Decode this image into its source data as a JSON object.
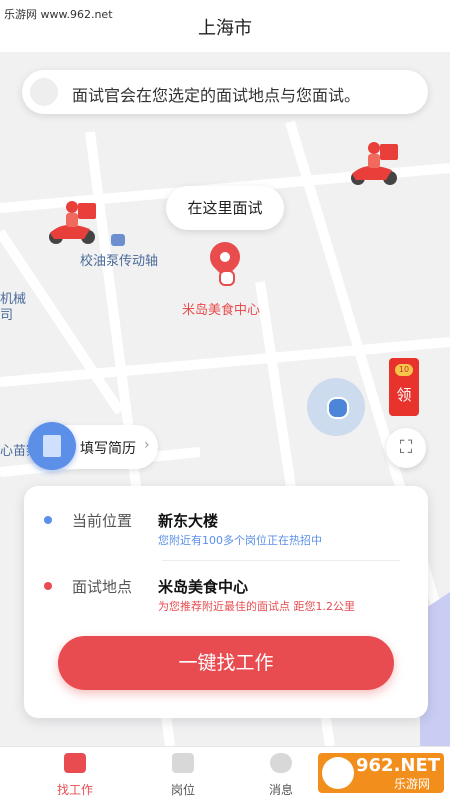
{
  "watermark_top": "乐游网 www.962.net",
  "header": {
    "title": "上海市"
  },
  "notice": {
    "text": "面试官会在您选定的面试地点与您面试。"
  },
  "map": {
    "bubble": "在这里面试",
    "poi_name": "米岛美食中心",
    "labels": {
      "bus_stop": "校油泵传动轴",
      "left_1": "机械",
      "left_2": "司",
      "left_3": "心苗察"
    },
    "red_envelope": {
      "coin": "10",
      "label": "领"
    }
  },
  "resume": {
    "label": "填写简历",
    "arrow": "›"
  },
  "card": {
    "current": {
      "label": "当前位置",
      "value": "新东大楼",
      "sub": "您附近有100多个岗位正在热招中",
      "dot_color": "#5b8fe8",
      "sub_color": "#5b8fe8"
    },
    "interview": {
      "label": "面试地点",
      "value": "米岛美食中心",
      "sub": "为您推荐附近最佳的面试点 距您1.2公里",
      "dot_color": "#e84c50",
      "sub_color": "#e84c50"
    },
    "cta": "一键找工作"
  },
  "tabs": [
    {
      "label": "找工作",
      "active": true
    },
    {
      "label": "岗位",
      "active": false
    },
    {
      "label": "消息",
      "active": false
    }
  ],
  "watermark_br": {
    "big": "962.NET",
    "small": "乐游网"
  },
  "colors": {
    "accent": "#e84c50",
    "blue": "#5b8fe8"
  }
}
